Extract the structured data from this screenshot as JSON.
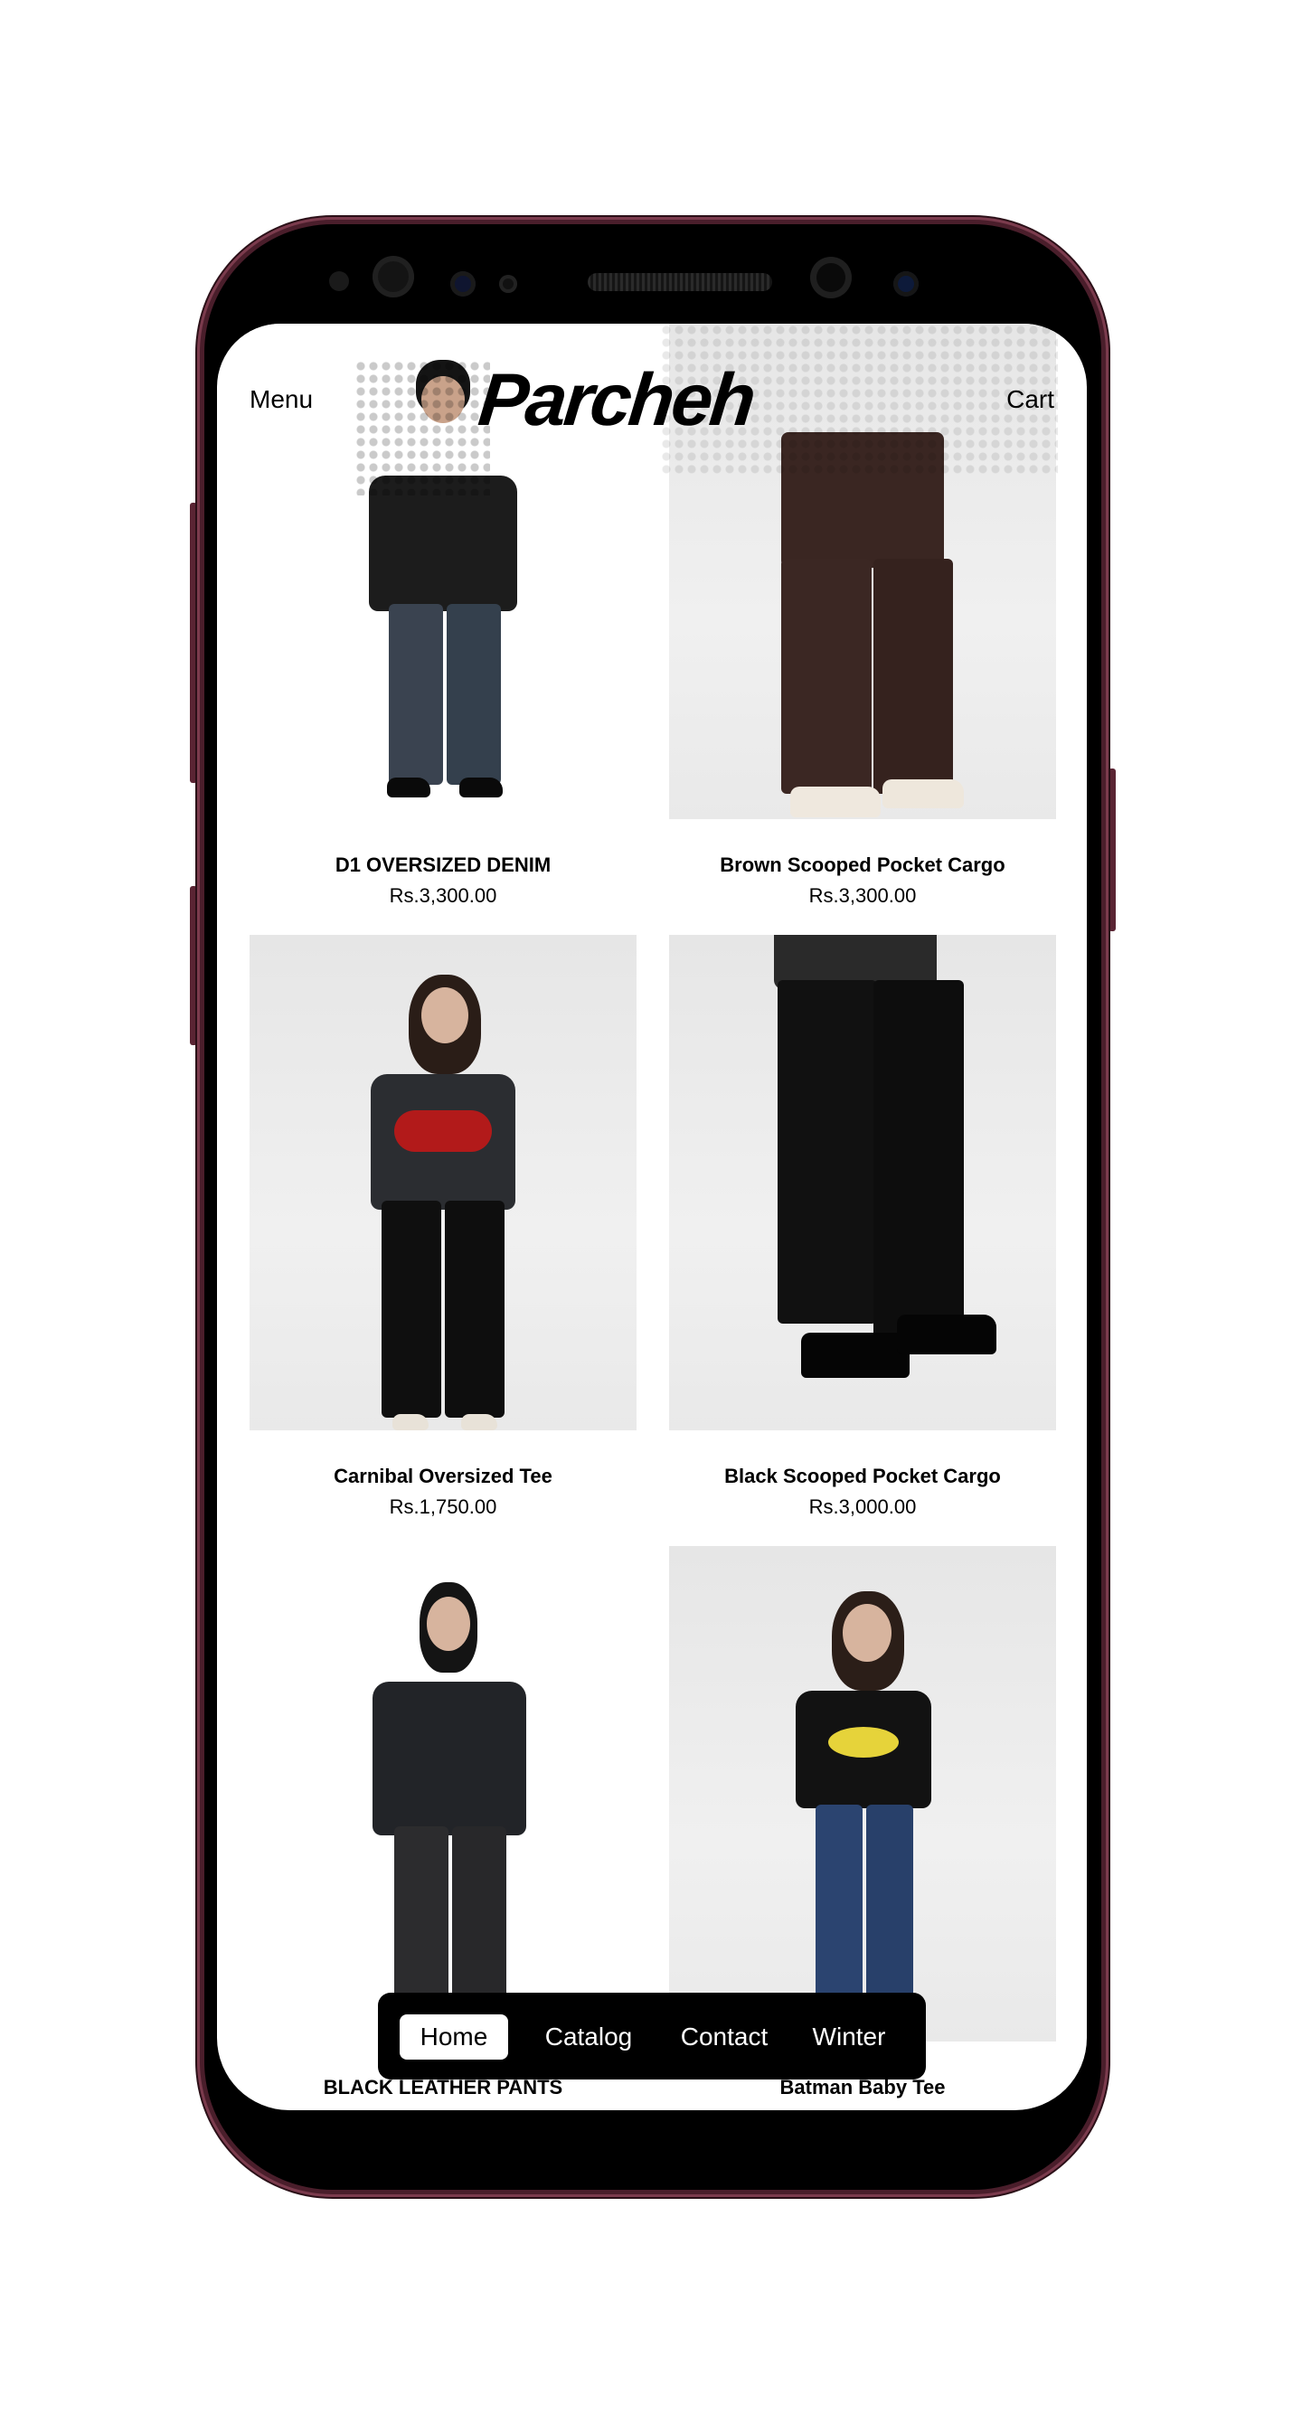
{
  "header": {
    "menu_label": "Menu",
    "logo": "Parcheh",
    "cart_label": "Cart"
  },
  "products": [
    {
      "title": "D1 OVERSIZED DENIM",
      "price": "Rs.3,300.00"
    },
    {
      "title": "Brown Scooped Pocket Cargo",
      "price": "Rs.3,300.00"
    },
    {
      "title": "Carnibal Oversized Tee",
      "price": "Rs.1,750.00"
    },
    {
      "title": "Black Scooped Pocket Cargo",
      "price": "Rs.3,000.00"
    },
    {
      "title": "BLACK LEATHER PANTS",
      "price": ""
    },
    {
      "title": "Batman Baby Tee",
      "price": ""
    }
  ],
  "tabbar": {
    "tabs": [
      "Home",
      "Catalog",
      "Contact",
      "Winter"
    ],
    "active": "Home"
  },
  "colors": {
    "frame": "#4a1e2b",
    "tabbar_bg": "#000000",
    "tab_active_bg": "#ffffff"
  }
}
